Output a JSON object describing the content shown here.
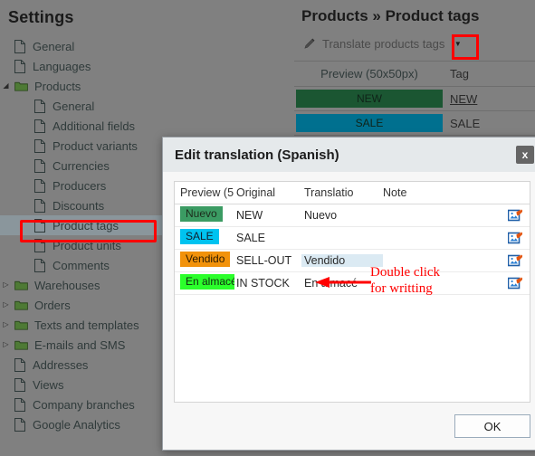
{
  "sidebar": {
    "title": "Settings",
    "items": [
      {
        "label": "General",
        "type": "doc",
        "level": 0,
        "expander": "",
        "selected": false
      },
      {
        "label": "Languages",
        "type": "doc",
        "level": 0,
        "expander": "",
        "selected": false
      },
      {
        "label": "Products",
        "type": "folder",
        "level": 0,
        "expander": "▾",
        "selected": false
      },
      {
        "label": "General",
        "type": "doc",
        "level": 1,
        "expander": "",
        "selected": false
      },
      {
        "label": "Additional fields",
        "type": "doc",
        "level": 1,
        "expander": "",
        "selected": false
      },
      {
        "label": "Product variants",
        "type": "doc",
        "level": 1,
        "expander": "",
        "selected": false
      },
      {
        "label": "Currencies",
        "type": "doc",
        "level": 1,
        "expander": "",
        "selected": false
      },
      {
        "label": "Producers",
        "type": "doc",
        "level": 1,
        "expander": "",
        "selected": false
      },
      {
        "label": "Discounts",
        "type": "doc",
        "level": 1,
        "expander": "",
        "selected": false
      },
      {
        "label": "Product tags",
        "type": "doc",
        "level": 1,
        "expander": "",
        "selected": true
      },
      {
        "label": "Product units",
        "type": "doc",
        "level": 1,
        "expander": "",
        "selected": false
      },
      {
        "label": "Comments",
        "type": "doc",
        "level": 1,
        "expander": "",
        "selected": false
      },
      {
        "label": "Warehouses",
        "type": "folder",
        "level": 0,
        "expander": "▸",
        "selected": false
      },
      {
        "label": "Orders",
        "type": "folder",
        "level": 0,
        "expander": "▸",
        "selected": false
      },
      {
        "label": "Texts and templates",
        "type": "folder",
        "level": 0,
        "expander": "▸",
        "selected": false
      },
      {
        "label": "E-mails and SMS",
        "type": "folder",
        "level": 0,
        "expander": "▸",
        "selected": false
      },
      {
        "label": "Addresses",
        "type": "doc",
        "level": 0,
        "expander": "",
        "selected": false
      },
      {
        "label": "Views",
        "type": "doc",
        "level": 0,
        "expander": "",
        "selected": false
      },
      {
        "label": "Company branches",
        "type": "doc",
        "level": 0,
        "expander": "",
        "selected": false
      },
      {
        "label": "Google Analytics",
        "type": "doc",
        "level": 0,
        "expander": "",
        "selected": false
      }
    ]
  },
  "content": {
    "title": "Products » Product tags",
    "toolbar": {
      "translate_label": "Translate products tags",
      "caret_glyph": "▼"
    },
    "table": {
      "headers": {
        "preview": "Preview (50x50px)",
        "tag": "Tag"
      },
      "rows": [
        {
          "preview_text": "NEW",
          "preview_color": "#1b5632",
          "tag": "NEW",
          "linked": true
        },
        {
          "preview_text": "SALE",
          "preview_color": "#00708f",
          "tag": "SALE",
          "linked": false
        }
      ]
    }
  },
  "dialog": {
    "title": "Edit translation (Spanish)",
    "close_label": "x",
    "headers": {
      "preview": "Preview (5",
      "original": "Original",
      "translation": "Translatio",
      "note": "Note"
    },
    "rows": [
      {
        "preview_text": "Nuevo",
        "preview_color": "#3b9b63",
        "preview_text_color": "#1c2b1c",
        "original": "NEW",
        "translation": "Nuevo",
        "translation_selected": false,
        "note": ""
      },
      {
        "preview_text": "SALE",
        "preview_color": "#00c3f0",
        "preview_text_color": "#102030",
        "original": "SALE",
        "translation": "",
        "translation_selected": false,
        "note": ""
      },
      {
        "preview_text": "Vendido",
        "preview_color": "#f2920b",
        "preview_text_color": "#2b1a00",
        "original": "SELL-OUT",
        "translation": "Vendido",
        "translation_selected": true,
        "note": ""
      },
      {
        "preview_text": "En almacé",
        "preview_color": "#2bff2b",
        "preview_text_color": "#102b10",
        "original": "IN STOCK",
        "translation": "En almacé",
        "translation_selected": false,
        "note": ""
      }
    ],
    "ok_label": "OK"
  },
  "annotations": {
    "note_line1": "Double click",
    "note_line2": "for writting",
    "color": "#FF0000"
  },
  "colors": {
    "accent_red": "#FF0000",
    "sidebar_bg": "#808080",
    "dialog_titlebar": "#E5E9EB",
    "selection_blue": "#DBEAF3"
  }
}
